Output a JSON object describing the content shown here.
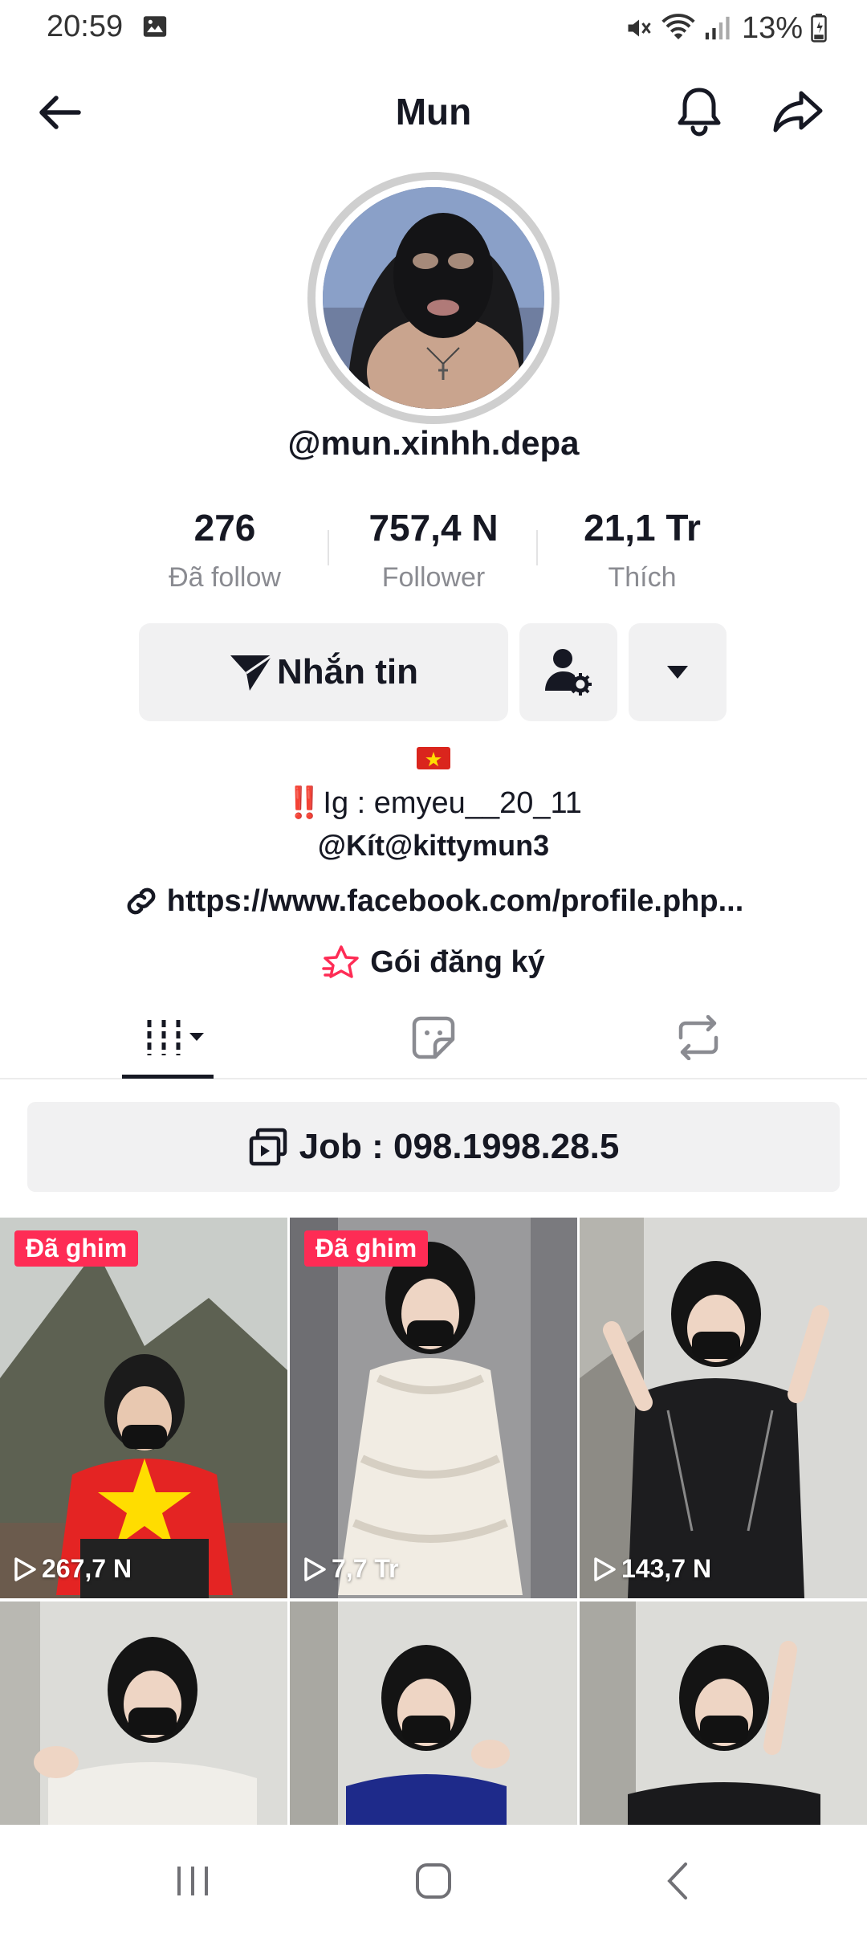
{
  "status_bar": {
    "time": "20:59",
    "battery": "13%",
    "icons": [
      "gallery-icon",
      "mute-icon",
      "wifi-icon",
      "signal-icon",
      "battery-icon"
    ]
  },
  "header": {
    "title": "Mun",
    "icons": [
      "back-arrow-icon",
      "bell-icon",
      "share-icon"
    ]
  },
  "profile": {
    "username": "@mun.xinhh.depa",
    "stats": [
      {
        "value": "276",
        "label": "Đã follow"
      },
      {
        "value": "757,4 N",
        "label": "Follower"
      },
      {
        "value": "21,1 Tr",
        "label": "Thích"
      }
    ],
    "message_label": "Nhắn tin",
    "bio": {
      "flag": "vietnam-flag-icon",
      "ig_prefix": "‼️",
      "ig_text": "Ig : emyeu__20_11",
      "mention": "@Kít@kittymun3",
      "link": "https://www.facebook.com/profile.php...",
      "subscription": "Gói đăng ký"
    }
  },
  "tabs": [
    "videos-grid-icon",
    "liked-sticker-icon",
    "repost-icon"
  ],
  "job_banner": {
    "text": "Job : 098.1998.28.5"
  },
  "videos": [
    {
      "pinned": "Đã ghim",
      "views": "267,7 N"
    },
    {
      "pinned": "Đã ghim",
      "views": "7,7 Tr"
    },
    {
      "pinned": "",
      "views": "143,7 N"
    },
    {
      "pinned": "",
      "views": ""
    },
    {
      "pinned": "",
      "views": ""
    },
    {
      "pinned": "",
      "views": ""
    }
  ],
  "colors": {
    "accent": "#fe2c55",
    "button_bg": "#f1f1f2",
    "text": "#161823",
    "muted": "#8a8b91"
  }
}
